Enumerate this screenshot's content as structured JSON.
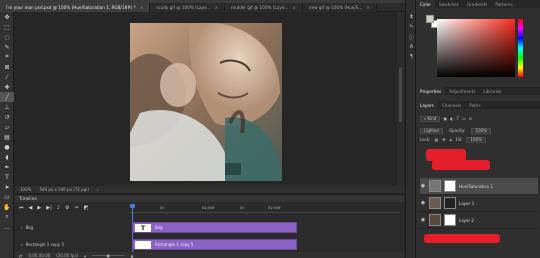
{
  "tabs": [
    {
      "label": "i'm your man psd.psd @ 100% (Hue/Saturation 1, RGB/16#) *",
      "active": true
    },
    {
      "label": "scully gif @ 100% (Laye...",
      "active": false
    },
    {
      "label": "mulder gif @ 100% (Laye...",
      "active": false
    },
    {
      "label": "new gif @ 100% (Hue/S...",
      "active": false
    }
  ],
  "status": {
    "zoom": "100%",
    "doc_size": "540 px x 540 px (72 ppi)"
  },
  "timeline": {
    "title": "Timeline",
    "ruler": [
      "0f",
      "01:00f",
      "0f",
      "02:00f"
    ],
    "tracks": [
      {
        "label": "Bkg",
        "clip": "Bkg",
        "clip_icon": "T"
      },
      {
        "label": "Rectangle 1 copy 5",
        "clip": "Rectangle 1 copy 5",
        "clip_icon": ""
      }
    ],
    "timecode": "0:00:00:00",
    "fps": "(30.00 fps)"
  },
  "color_panel": {
    "tabs": [
      "Color",
      "Swatches",
      "Gradients",
      "Patterns"
    ],
    "active": "Color"
  },
  "properties_panel": {
    "tabs": [
      "Properties",
      "Adjustments",
      "Libraries"
    ],
    "active": "Properties"
  },
  "layers_panel": {
    "tabs": [
      "Layers",
      "Channels",
      "Paths"
    ],
    "active": "Layers",
    "filter": "Kind",
    "blend_mode": "Lighten",
    "opacity_label": "Opacity:",
    "opacity": "100%",
    "lock_label": "Lock:",
    "fill_label": "Fill:",
    "fill": "100%",
    "layers": [
      {
        "name": "Hue/Saturation 1",
        "selected": true
      },
      {
        "name": "Layer 3",
        "selected": false
      },
      {
        "name": "Layer 2",
        "selected": false
      }
    ]
  },
  "colors": {
    "accent": "#4a7ad6",
    "clip": "#8a63c4",
    "redaction": "#e41e2b"
  }
}
